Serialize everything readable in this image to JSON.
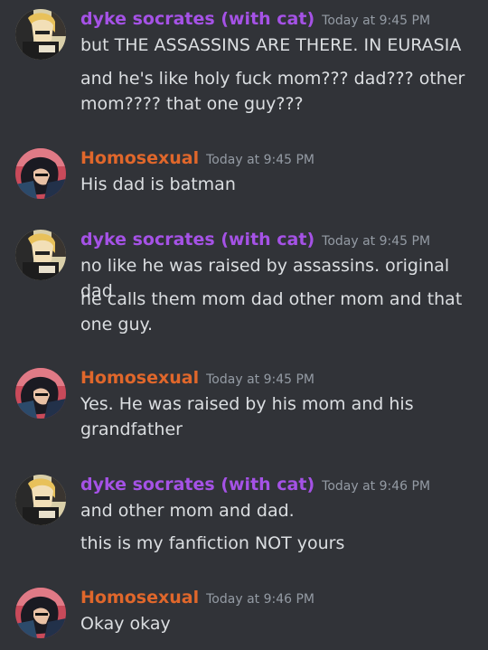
{
  "colors": {
    "background": "#313338",
    "author_purple": "#a552e6",
    "author_orange": "#e0672b",
    "timestamp": "#949ba4",
    "text": "#dbdee1"
  },
  "messages": [
    {
      "author": "dyke socrates (with cat)",
      "author_color": "#a552e6",
      "avatar": "cartoon-blonde-avatar-icon",
      "timestamp": "Today at 9:45 PM",
      "lines": [
        "but THE ASSASSINS ARE THERE. IN EURASIA",
        "and he's like holy fuck  mom??? dad??? other mom???? that one guy???"
      ]
    },
    {
      "author": "Homosexual",
      "author_color": "#e0672b",
      "avatar": "dark-haired-comic-avatar-icon",
      "timestamp": "Today at 9:45 PM",
      "lines": [
        "His dad is batman"
      ]
    },
    {
      "author": "dyke socrates (with cat)",
      "author_color": "#a552e6",
      "avatar": "cartoon-blonde-avatar-icon",
      "timestamp": "Today at 9:45 PM",
      "lines": [
        "no like he was raised by assassins. original dad",
        "he calls them mom dad other mom and that one guy."
      ]
    },
    {
      "author": "Homosexual",
      "author_color": "#e0672b",
      "avatar": "dark-haired-comic-avatar-icon",
      "timestamp": "Today at 9:45 PM",
      "lines": [
        "Yes. He was raised by his mom and his grandfather"
      ]
    },
    {
      "author": "dyke socrates (with cat)",
      "author_color": "#a552e6",
      "avatar": "cartoon-blonde-avatar-icon",
      "timestamp": "Today at 9:46 PM",
      "lines": [
        "and other mom and dad.",
        "this is my fanfiction NOT yours"
      ]
    },
    {
      "author": "Homosexual",
      "author_color": "#e0672b",
      "avatar": "dark-haired-comic-avatar-icon",
      "timestamp": "Today at 9:46 PM",
      "lines": [
        "Okay okay"
      ]
    }
  ]
}
